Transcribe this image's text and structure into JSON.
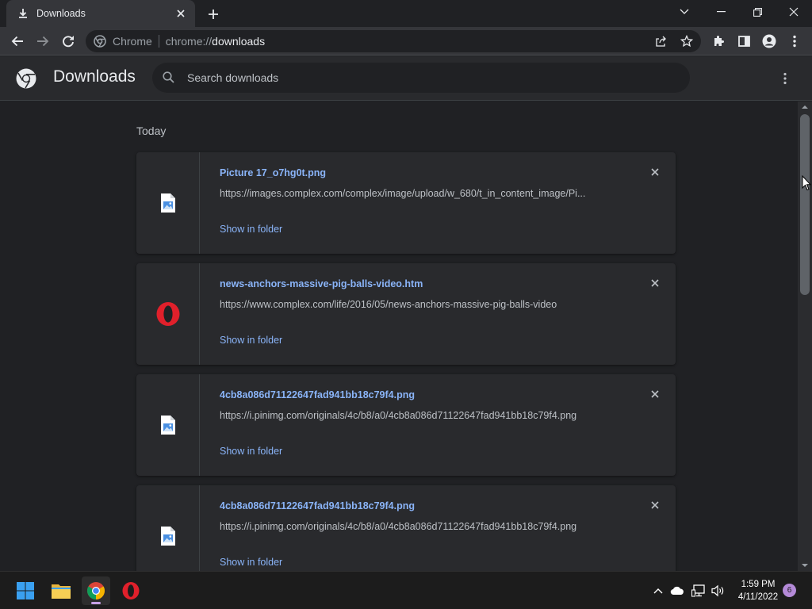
{
  "browser": {
    "tab": {
      "title": "Downloads",
      "icon": "download-icon"
    },
    "omnibox": {
      "chip": "Chrome",
      "url_scheme": "chrome://",
      "url_host": "downloads"
    }
  },
  "page": {
    "title": "Downloads",
    "search": {
      "placeholder": "Search downloads"
    },
    "section": "Today",
    "items": [
      {
        "filename": "Picture 17_o7hg0t.png",
        "url": "https://images.complex.com/complex/image/upload/w_680/t_in_content_image/Pi...",
        "action": "Show in folder",
        "icon": "image-file-icon"
      },
      {
        "filename": "news-anchors-massive-pig-balls-video.htm",
        "url": "https://www.complex.com/life/2016/05/news-anchors-massive-pig-balls-video",
        "action": "Show in folder",
        "icon": "opera-icon"
      },
      {
        "filename": "4cb8a086d71122647fad941bb18c79f4.png",
        "url": "https://i.pinimg.com/originals/4c/b8/a0/4cb8a086d71122647fad941bb18c79f4.png",
        "action": "Show in folder",
        "icon": "image-file-icon"
      },
      {
        "filename": "4cb8a086d71122647fad941bb18c79f4.png",
        "url": "https://i.pinimg.com/originals/4c/b8/a0/4cb8a086d71122647fad941bb18c79f4.png",
        "action": "Show in folder",
        "icon": "image-file-icon"
      }
    ]
  },
  "taskbar": {
    "time": "1:59 PM",
    "date": "4/11/2022",
    "notifications": "6"
  },
  "colors": {
    "accent_link": "#8ab4f8",
    "page_bg": "#202124",
    "card_bg": "#292a2d",
    "toolbar_bg": "#35363a",
    "opera_red": "#e0202b"
  }
}
